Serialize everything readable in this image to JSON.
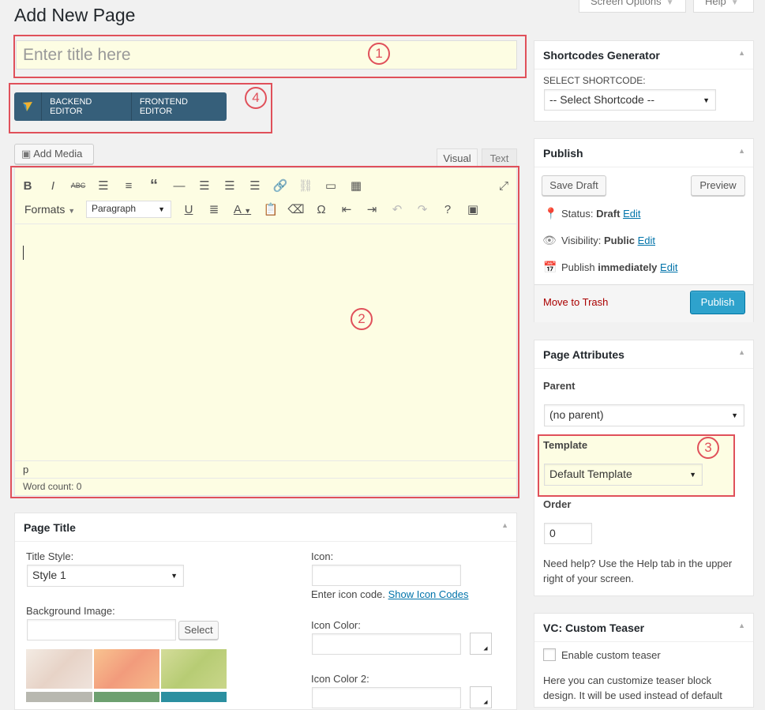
{
  "header": {
    "title": "Add New Page",
    "screen_options": "Screen Options",
    "help": "Help"
  },
  "annotations": [
    "1",
    "2",
    "3",
    "4"
  ],
  "title_input": {
    "placeholder": "Enter title here"
  },
  "vc": {
    "backend": "BACKEND EDITOR",
    "frontend": "FRONTEND EDITOR"
  },
  "editor": {
    "add_media": "Add Media",
    "tab_visual": "Visual",
    "tab_text": "Text",
    "formats": "Formats",
    "paragraph": "Paragraph",
    "path": "p",
    "word_count": "Word count: 0"
  },
  "page_title_box": {
    "heading": "Page Title",
    "title_style_label": "Title Style:",
    "title_style_value": "Style 1",
    "bg_image_label": "Background Image:",
    "select_button": "Select",
    "icon_label": "Icon:",
    "icon_help": "Enter icon code.",
    "show_icon_codes": "Show Icon Codes",
    "icon_color_label": "Icon Color:",
    "icon_color2_label": "Icon Color 2:"
  },
  "shortcodes": {
    "heading": "Shortcodes Generator",
    "select_label": "SELECT SHORTCODE:",
    "select_value": "-- Select Shortcode --"
  },
  "publish": {
    "heading": "Publish",
    "save_draft": "Save Draft",
    "preview": "Preview",
    "status_label": "Status:",
    "status_value": "Draft",
    "visibility_label": "Visibility:",
    "visibility_value": "Public",
    "publish_label": "Publish",
    "publish_value": "immediately",
    "edit": "Edit",
    "move_to_trash": "Move to Trash",
    "publish_button": "Publish"
  },
  "page_attributes": {
    "heading": "Page Attributes",
    "parent_label": "Parent",
    "parent_value": "(no parent)",
    "template_label": "Template",
    "template_value": "Default Template",
    "order_label": "Order",
    "order_value": "0",
    "help_text": "Need help? Use the Help tab in the upper right of your screen."
  },
  "vc_teaser": {
    "heading": "VC: Custom Teaser",
    "enable_label": "Enable custom teaser",
    "description": "Here you can customize teaser block design. It will be used instead of default"
  },
  "colors": {
    "annotation": "#e0505a",
    "highlight_bg": "#fdfde3",
    "vc_bar": "#365f7a",
    "primary": "#2ea2cc",
    "trash": "#a00"
  }
}
